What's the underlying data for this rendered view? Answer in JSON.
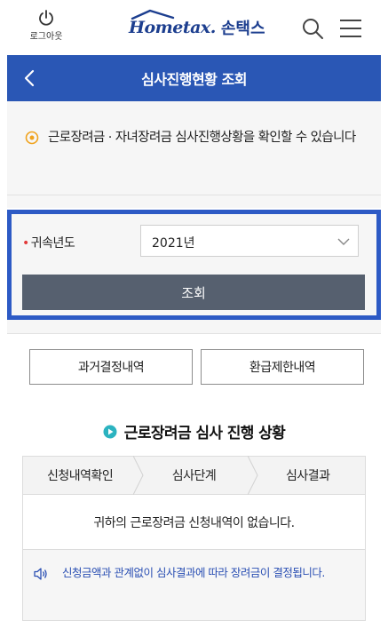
{
  "header": {
    "logout_label": "로그아웃",
    "logo_en": "Hometax.",
    "logo_ko": "손택스"
  },
  "titlebar": {
    "title": "심사진행현황 조회"
  },
  "notice": {
    "text": "근로장려금 · 자녀장려금 심사진행상황을 확인할 수 있습니다"
  },
  "form": {
    "year_label": "귀속년도",
    "required_mark": "•",
    "year_value": "2021년",
    "query_button": "조회"
  },
  "actions": {
    "past_decisions": "과거결정내역",
    "refund_limits": "환급제한내역"
  },
  "section": {
    "title": "근로장려금 심사 진행 상황"
  },
  "steps": [
    "신청내역확인",
    "심사단계",
    "심사결과"
  ],
  "result": {
    "message": "귀하의 근로장려금 신청내역이 없습니다.",
    "note": "신청금액과 관계없이 심사결과에 따라 장려금이 결정됩니다."
  },
  "colors": {
    "brand_blue": "#2a57b5",
    "highlight_border": "#2d5ac5",
    "button_gray": "#56606f",
    "note_blue": "#2a4fb3"
  },
  "icons": {
    "logout": "power-icon",
    "search": "search-icon",
    "menu": "hamburger-menu-icon",
    "back": "chevron-left-icon",
    "notice": "circle-bullet-icon",
    "select": "chevron-down-icon",
    "section": "circle-play-icon",
    "speaker": "speaker-icon"
  }
}
